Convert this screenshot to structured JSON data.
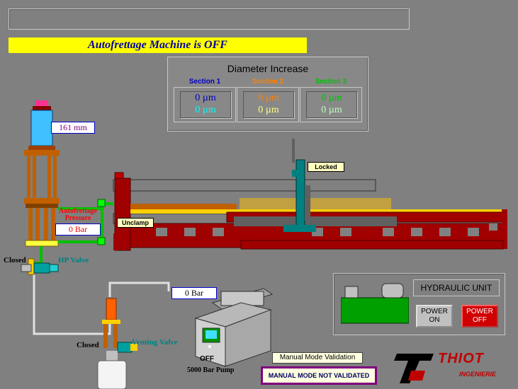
{
  "status_text": "Autofrettage Machine is OFF",
  "diameter_panel": {
    "title": "Diameter Increase",
    "sections": [
      {
        "label": "Section 1",
        "value1": "0 µm",
        "value2": "0 µm",
        "color": "#0000c0",
        "color2": "#00ffff"
      },
      {
        "label": "Section 2",
        "value1": "0 µm",
        "value2": "0 µm",
        "color": "#ff8000",
        "color2": "#ffff80"
      },
      {
        "label": "Section 3",
        "value1": "0 µm",
        "value2": "0 µm",
        "color": "#00c000",
        "color2": "#c0ffc0"
      }
    ]
  },
  "cylinder_position": "161 mm",
  "autofrettage_pressure": {
    "label": "Autofrettage Pressure",
    "value": "0 Bar"
  },
  "hp_valve": {
    "state": "Closed",
    "label": "HP Valve"
  },
  "venting_valve": {
    "state": "Closed",
    "label": "Venting Valve"
  },
  "pump": {
    "pressure": "0 Bar",
    "state": "OFF",
    "label": "5000 Bar Pump"
  },
  "machine": {
    "lock_state": "Locked",
    "clamp_button": "Unclamp"
  },
  "hydraulic_unit": {
    "title": "HYDRAULIC UNIT",
    "power_on": "POWER ON",
    "power_off": "POWER OFF"
  },
  "manual_mode": {
    "button": "Manual Mode Validation",
    "status": "MANUAL MODE NOT VALIDATED"
  },
  "logo": {
    "brand": "THIOT",
    "sub": "INGENIERIE"
  },
  "colors": {
    "background": "#808080",
    "status_bg": "#ffff00",
    "machine_red": "#a00000",
    "pipe_green": "#00c000",
    "power_off": "#d00000"
  }
}
